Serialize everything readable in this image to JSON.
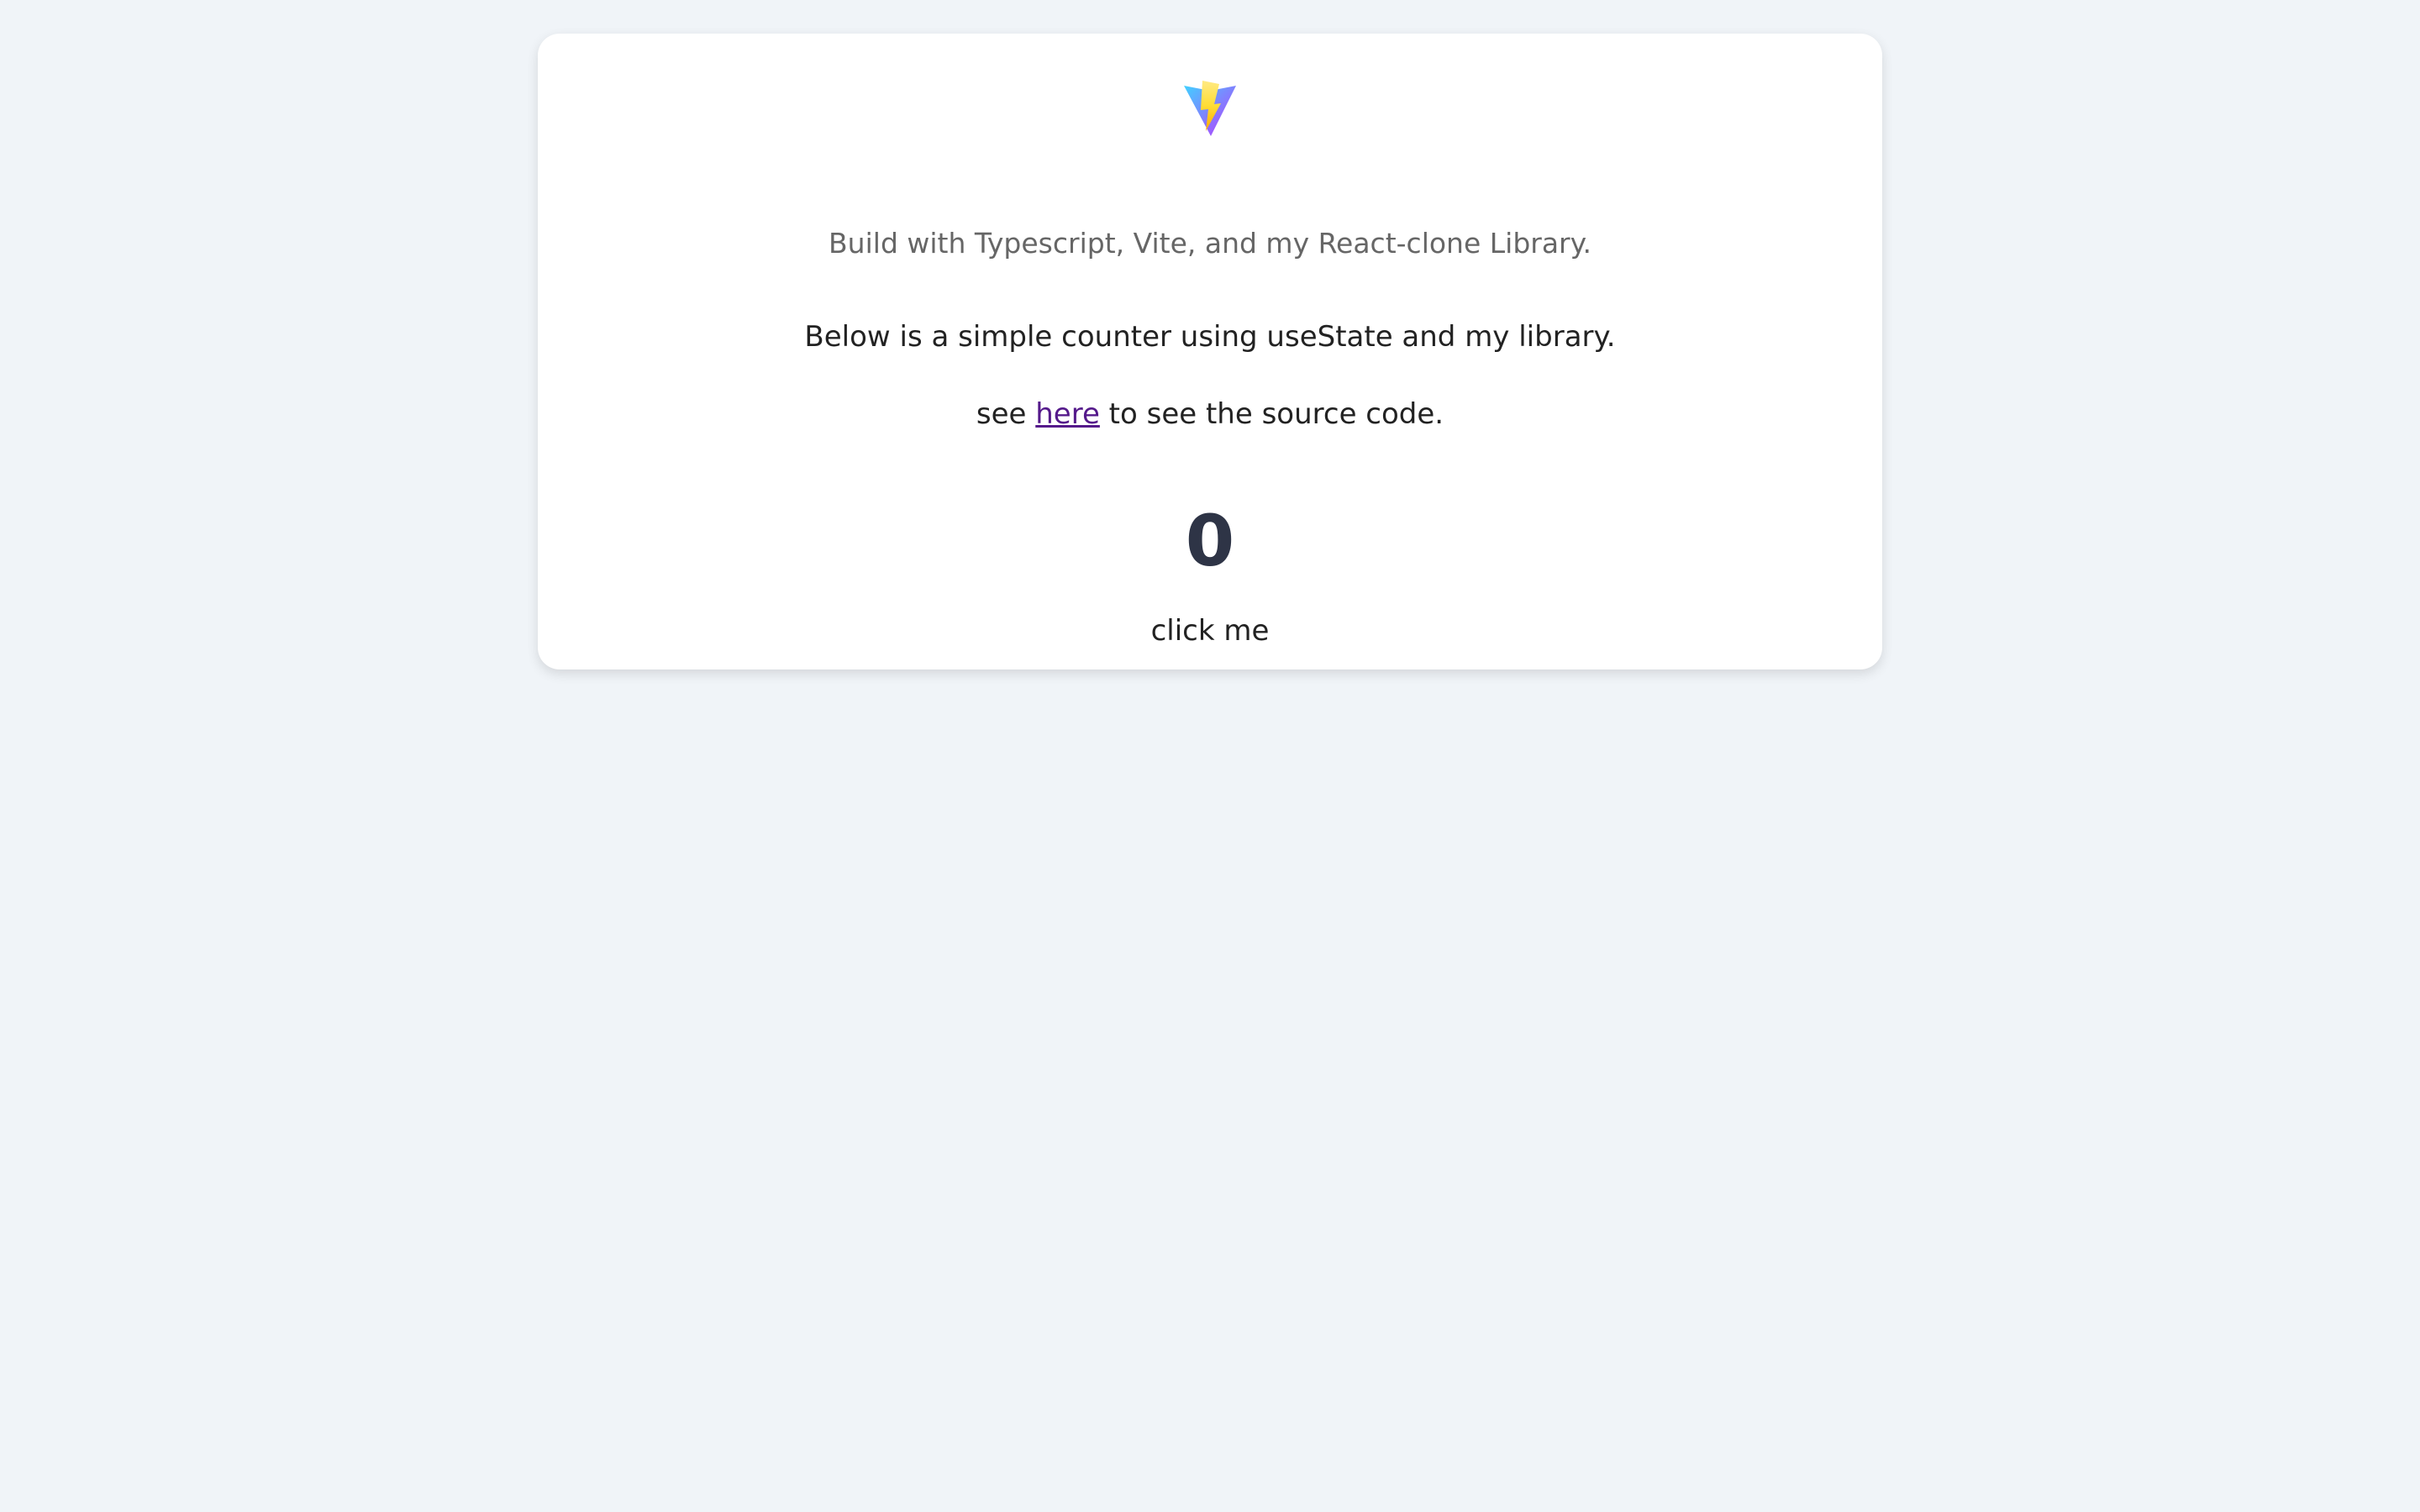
{
  "page": {
    "background": "#f0f4f8"
  },
  "header": {
    "logo_icon": "vite-logo-icon",
    "subtitle": "Build with Typescript, Vite, and my React-clone Library."
  },
  "content": {
    "description": "Below is a simple counter using useState and my library.",
    "source_prefix": "see ",
    "source_link_text": "here",
    "source_suffix": " to see the source code."
  },
  "counter": {
    "value": "0",
    "button_label": "click me"
  },
  "colors": {
    "link": "#551a8b",
    "counter_text": "#2e3446",
    "subtitle_text": "#666666"
  }
}
